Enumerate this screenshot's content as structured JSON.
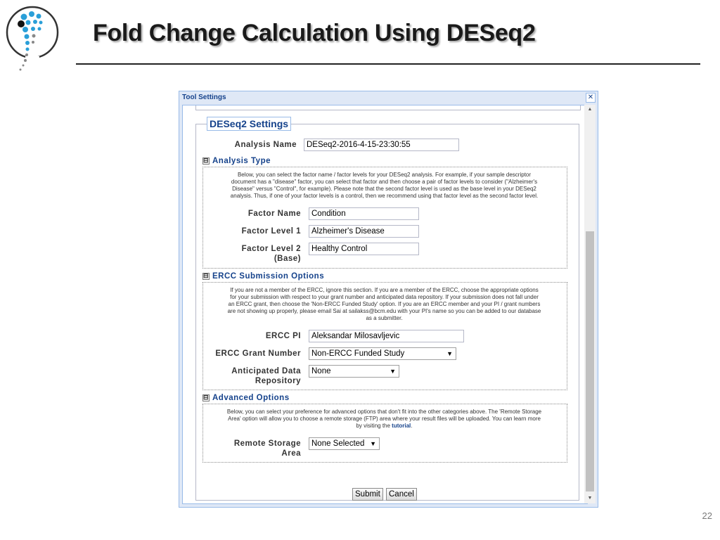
{
  "slide": {
    "title": "Fold Change Calculation Using DESeq2",
    "page_number": "22"
  },
  "dialog": {
    "title": "Tool Settings",
    "close_glyph": "✕",
    "legend": "DESeq2 Settings",
    "analysis_name": {
      "label": "Analysis Name",
      "value": "DESeq2-2016-4-15-23:30:55"
    },
    "analysis_type": {
      "title": "Analysis Type",
      "description_lines": [
        "Below, you can select the factor name / factor levels for your DESeq2 analysis. For example, if your sample descriptor",
        "document has a \"disease\" factor, you can select that factor and then choose a pair of factor levels to consider (\"Alzheimer's",
        "Disease\" versus \"Control\", for example). Please note that the second factor level is used as the base level in your DESeq2",
        "analysis. Thus, if one of your factor levels is a control, then we recommend using that factor level as the second factor level."
      ],
      "factor_name": {
        "label": "Factor Name",
        "value": "Condition"
      },
      "factor_level_1": {
        "label": "Factor Level 1",
        "value": "Alzheimer's Disease"
      },
      "factor_level_2": {
        "label_line1": "Factor Level 2",
        "label_line2": "(Base)",
        "value": "Healthy Control"
      }
    },
    "ercc": {
      "title": "ERCC Submission Options",
      "description_lines": [
        "If you are not a member of the ERCC, ignore this section. If you are a member of the ERCC, choose the appropriate options",
        "for your submission with respect to your grant number and anticipated data repository. If your submission does not fall under",
        "an ERCC grant, then choose the 'Non-ERCC Funded Study' option. If you are an ERCC member and your PI / grant numbers",
        "are not showing up properly, please email Sai at sailakss@bcm.edu with your PI's name so you can be added to our database",
        "as a submitter."
      ],
      "pi": {
        "label": "ERCC PI",
        "value": "Aleksandar Milosavljevic"
      },
      "grant": {
        "label": "ERCC Grant Number",
        "value": "Non-ERCC Funded Study"
      },
      "repository": {
        "label_line1": "Anticipated Data",
        "label_line2": "Repository",
        "value": "None"
      }
    },
    "advanced": {
      "title": "Advanced Options",
      "description_lines": [
        "Below, you can select your preference for advanced options that don't fit into the other categories above. The 'Remote Storage",
        "Area' option will allow you to choose a remote storage (FTP) area where your result files will be uploaded. You can learn more"
      ],
      "description_tail_prefix": "by visiting the ",
      "tutorial_link": "tutorial",
      "description_tail_suffix": ".",
      "remote_storage": {
        "label_line1": "Remote Storage",
        "label_line2": "Area",
        "value": "None Selected"
      }
    },
    "toggle_glyph": "⊟",
    "dropdown_glyph": "▼",
    "scroll_up_glyph": "▲",
    "scroll_down_glyph": "▼",
    "submit_label": "Submit",
    "cancel_label": "Cancel"
  },
  "colors": {
    "panel_header_text": "#15428b",
    "panel_border": "#99bbe8",
    "panel_bg": "#dfe8f6"
  }
}
